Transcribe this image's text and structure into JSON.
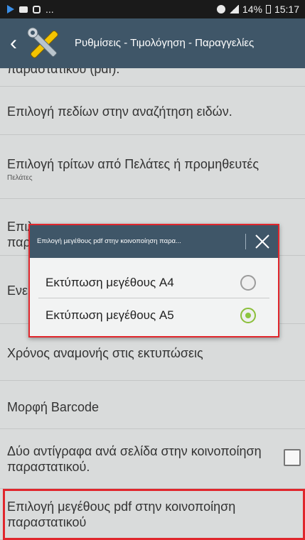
{
  "statusbar": {
    "battery": "14%",
    "time": "15:17",
    "ellipsis": "..."
  },
  "appbar": {
    "title": "Ρυθμίσεις - Τιμολόγηση - Παραγγελίες"
  },
  "list": {
    "top_fragment": "παραστατικού (pdf).",
    "items": [
      {
        "title": "Επιλογή πεδίων στην αναζήτηση ειδών."
      },
      {
        "title": "Επιλογή τρίτων από Πελάτες ή προμηθευτές",
        "summary": "Πελάτες"
      },
      {
        "title": "Επιλ",
        "title2": "παρ"
      },
      {
        "title": "Ενε"
      },
      {
        "title": "Χρόνος αναμονής στις εκτυπώσεις"
      },
      {
        "title": "Μορφή Barcode"
      },
      {
        "title": "Δύο αντίγραφα ανά σελίδα στην κοινοποίηση παραστατικού.",
        "checked": false
      },
      {
        "title": "Επιλογή μεγέθους pdf στην κοινοποίηση παραστατικού"
      }
    ]
  },
  "dialog": {
    "title": "Επιλογή μεγέθους pdf στην κοινοποίηση παρα...",
    "options": [
      {
        "label": "Εκτύπωση μεγέθους A4",
        "selected": false
      },
      {
        "label": "Εκτύπωση μεγέθους A5",
        "selected": true
      }
    ]
  },
  "colors": {
    "appbar": "#3f5668",
    "highlight": "#e0262c",
    "radio_on": "#8bc53f"
  }
}
